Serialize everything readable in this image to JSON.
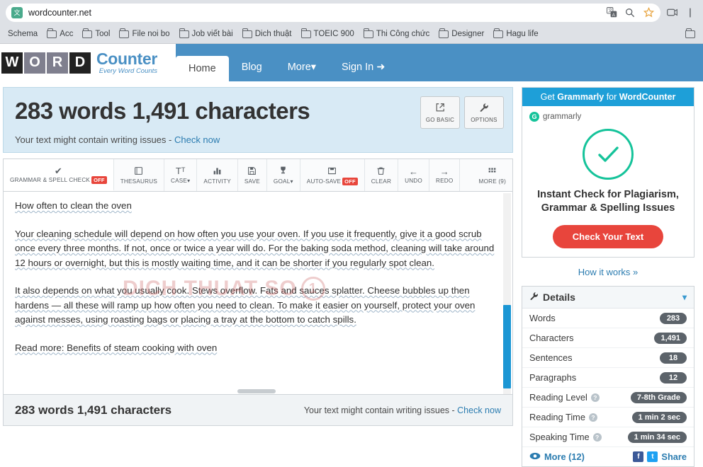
{
  "browser": {
    "url": "wordcounter.net",
    "site_icon": "translate-page-icon",
    "omnibox_icons": [
      "translate-icon",
      "search-icon",
      "star-icon"
    ],
    "chrome_icons": [
      "extensions-icon",
      "menu-icon"
    ]
  },
  "bookmarks": [
    {
      "label": "Schema",
      "icon": "none"
    },
    {
      "label": "Acc",
      "icon": "folder-icon"
    },
    {
      "label": "Tool",
      "icon": "folder-icon"
    },
    {
      "label": "File noi bo",
      "icon": "folder-icon"
    },
    {
      "label": "Job viết bài",
      "icon": "folder-icon"
    },
    {
      "label": "Dich thuật",
      "icon": "folder-icon"
    },
    {
      "label": "TOEIC 900",
      "icon": "folder-icon"
    },
    {
      "label": "Thi Công chức",
      "icon": "folder-icon"
    },
    {
      "label": "Designer",
      "icon": "folder-icon"
    },
    {
      "label": "Hagu life",
      "icon": "folder-icon"
    }
  ],
  "site": {
    "logo_letters": [
      "W",
      "O",
      "R",
      "D"
    ],
    "logo_name": "Counter",
    "logo_tagline": "Every Word Counts",
    "nav": [
      {
        "label": "Home",
        "active": true
      },
      {
        "label": "Blog",
        "active": false
      },
      {
        "label": "More",
        "active": false,
        "caret": true
      },
      {
        "label": "Sign In",
        "active": false,
        "icon": "sign-in-icon"
      }
    ]
  },
  "counter": {
    "headline": "283 words 1,491 characters",
    "notice_text": "Your text might contain writing issues - ",
    "notice_link": "Check now",
    "buttons": [
      {
        "label": "GO BASIC",
        "icon": "external-link-icon",
        "glyph": "↗"
      },
      {
        "label": "OPTIONS",
        "icon": "wrench-icon",
        "glyph": "🔧"
      }
    ]
  },
  "toolbar": [
    {
      "label": "GRAMMAR & SPELL CHECK",
      "glyph": "✔",
      "badge": "OFF",
      "active": true
    },
    {
      "label": "THESAURUS",
      "glyph": "📕",
      "badge": ""
    },
    {
      "label": "CASE",
      "glyph": "Tᵀ",
      "badge": "",
      "caret": true
    },
    {
      "label": "ACTIVITY",
      "glyph": "📊",
      "badge": ""
    },
    {
      "label": "SAVE",
      "glyph": "💾",
      "badge": ""
    },
    {
      "label": "GOAL",
      "glyph": "🏆",
      "badge": "",
      "caret": true
    },
    {
      "label": "AUTO-SAVE",
      "glyph": "💽",
      "badge": "OFF"
    },
    {
      "label": "CLEAR",
      "glyph": "🗑",
      "badge": ""
    },
    {
      "label": "UNDO",
      "glyph": "←",
      "badge": ""
    },
    {
      "label": "REDO",
      "glyph": "→",
      "badge": ""
    },
    {
      "label": "MORE (9)",
      "glyph": "▒",
      "badge": ""
    }
  ],
  "editor": {
    "heading": "How often to clean the oven",
    "paragraph1": "Your cleaning schedule will depend on how often you use your oven. If you use it frequently, give it a good scrub once every three months. If not, once or twice a year will do.  For the baking soda method, cleaning will take around 12 hours or overnight, but this is mostly waiting time, and it can be shorter if you regularly spot clean.",
    "paragraph2": "It also depends on what you usually cook. Stews overflow. Fats and sauces splatter. Cheese bubbles up then hardens — all these will ramp up how often you need to clean. To make it easier on yourself, protect your oven against messes, using roasting bags or placing a tray at the bottom to catch spills.",
    "paragraph3": "Read more: Benefits of steam cooking with oven",
    "watermark": "DICH THUAT SO",
    "watermark_mark": "1"
  },
  "status": {
    "left": "283 words 1,491 characters",
    "right_text": "Your text might contain writing issues - ",
    "right_link": "Check now"
  },
  "grammarly": {
    "header_prefix": "Get ",
    "header_brand": "Grammarly",
    "header_mid": " for ",
    "header_product": "WordCounter",
    "brand_label": "grammarly",
    "brand_mark": "G",
    "icon": "check-circle-icon",
    "title_line1": "Instant Check for Plagiarism,",
    "title_line2": "Grammar & Spelling Issues",
    "cta": "Check Your Text",
    "how_it_works": "How it works »"
  },
  "details": {
    "title": "Details",
    "title_icon": "wrench-icon",
    "collapse_icon": "chevron-down-icon",
    "rows": [
      {
        "label": "Words",
        "value": "283",
        "info": false
      },
      {
        "label": "Characters",
        "value": "1,491",
        "info": false
      },
      {
        "label": "Sentences",
        "value": "18",
        "info": false
      },
      {
        "label": "Paragraphs",
        "value": "12",
        "info": false
      },
      {
        "label": "Reading Level",
        "value": "7-8th Grade",
        "info": true
      },
      {
        "label": "Reading Time",
        "value": "1 min 2 sec",
        "info": true
      },
      {
        "label": "Speaking Time",
        "value": "1 min 34 sec",
        "info": true
      }
    ],
    "more_label": "More (12)",
    "share_label": "Share",
    "social": [
      {
        "name": "facebook-icon",
        "glyph": "f"
      },
      {
        "name": "twitter-icon",
        "glyph": "t"
      }
    ]
  },
  "colors": {
    "header_blue": "#4a90c4",
    "panel_blue": "#d8eaf5",
    "accent_link": "#2b7cb0",
    "grammarly_green": "#15c39a",
    "cta_red": "#e8453c",
    "badge_off": "#e8463c",
    "scroll_thumb": "#1b96d4"
  }
}
